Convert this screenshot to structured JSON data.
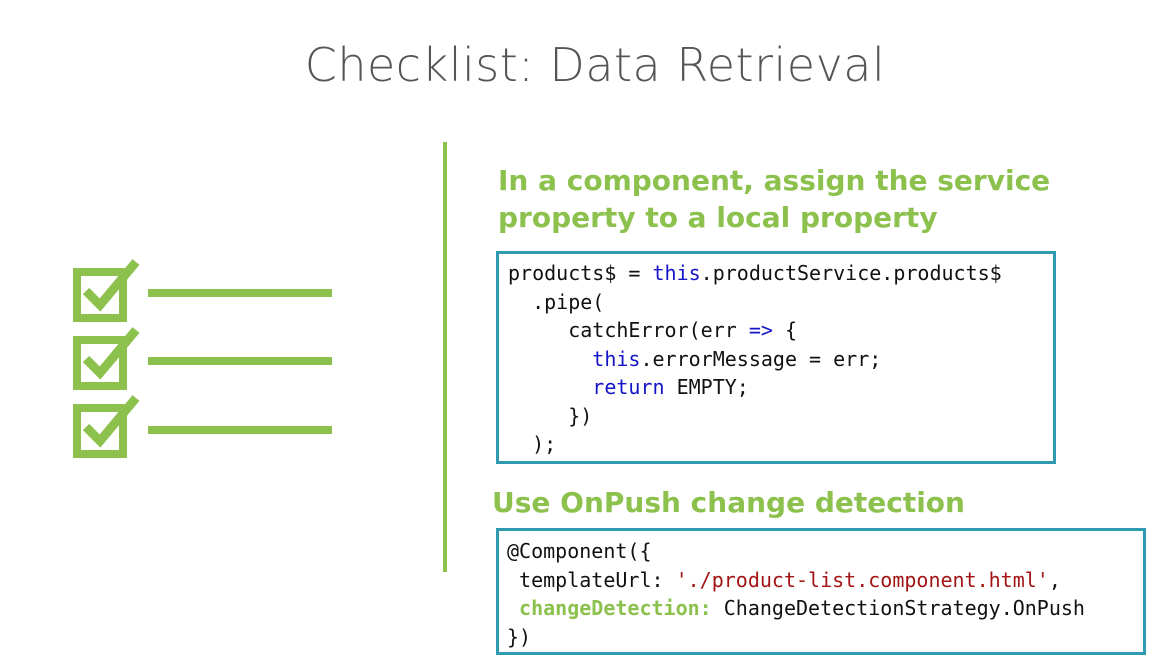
{
  "slide": {
    "title": "Checklist: Data Retrieval"
  },
  "section1": {
    "heading": "In a component, assign the service property to a local property",
    "code": {
      "l1_a": "products$ = ",
      "l1_kw": "this",
      "l1_b": ".productService.products$",
      "l2": "  .pipe(",
      "l3_a": "     catchError(err ",
      "l3_kw": "=>",
      "l3_b": " {",
      "l4_indent": "       ",
      "l4_kw": "this",
      "l4_b": ".errorMessage = err;",
      "l5_indent": "       ",
      "l5_kw": "return",
      "l5_b": " EMPTY;",
      "l6": "     })",
      "l7": "  );"
    }
  },
  "section2": {
    "heading": "Use OnPush change detection",
    "code": {
      "l1": "@Component({",
      "l2_a": " templateUrl: ",
      "l2_str": "'./product-list.component.html'",
      "l2_b": ",",
      "l3_indent": " ",
      "l3_hl": "changeDetection:",
      "l3_b": " ChangeDetectionStrategy.OnPush",
      "l4": "})"
    }
  },
  "colors": {
    "accent_green": "#8dc14e",
    "code_border": "#2e9bb0",
    "keyword_blue": "#1414c8",
    "string_red": "#a31515"
  },
  "icons": [
    "checklist-icon"
  ]
}
